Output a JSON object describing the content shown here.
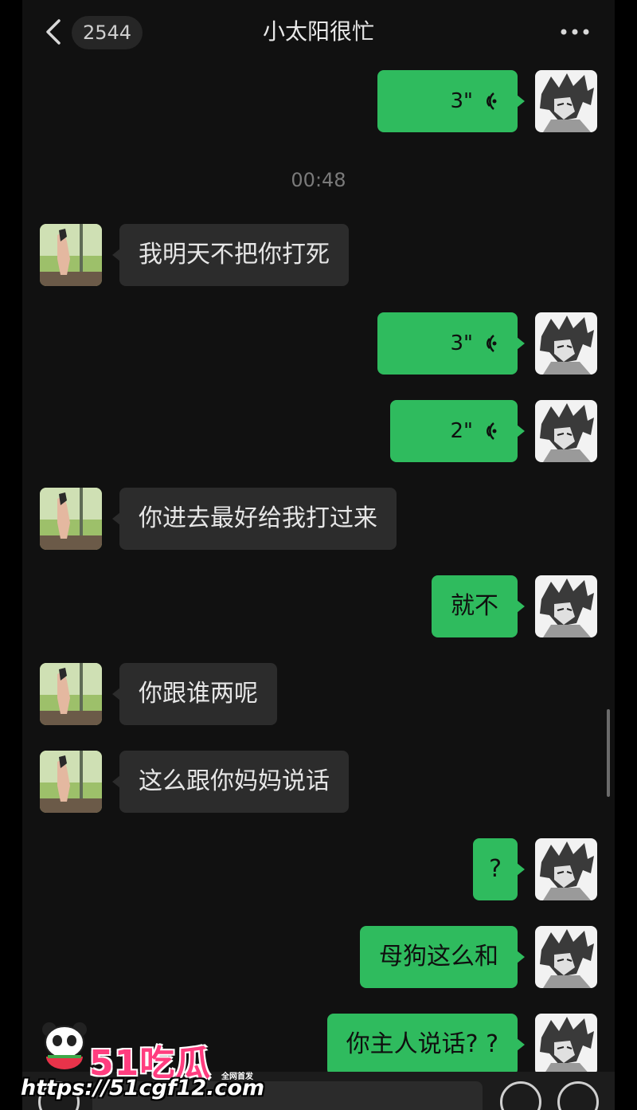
{
  "header": {
    "unread_count": "2544",
    "title": "小太阳很忙",
    "back_icon": "chevron-left-icon",
    "more_icon": "more-horizontal-icon"
  },
  "timestamp": "00:48",
  "messages": [
    {
      "side": "out",
      "type": "voice",
      "duration": "3\""
    },
    {
      "side": "in",
      "type": "text",
      "text": "我明天不把你打死"
    },
    {
      "side": "out",
      "type": "voice",
      "duration": "3\""
    },
    {
      "side": "out",
      "type": "voice",
      "duration": "2\""
    },
    {
      "side": "in",
      "type": "text",
      "text": "你进去最好给我打过来"
    },
    {
      "side": "out",
      "type": "text",
      "text": "就不"
    },
    {
      "side": "in",
      "type": "text",
      "text": "你跟谁两呢"
    },
    {
      "side": "in",
      "type": "text",
      "text": "这么跟你妈妈说话"
    },
    {
      "side": "out",
      "type": "text",
      "text": "?"
    },
    {
      "side": "out",
      "type": "text",
      "text": "母狗这么和"
    },
    {
      "side": "out",
      "type": "text",
      "text": "你主人说话? ?"
    }
  ],
  "colors": {
    "outgoing_bubble": "#2fbb5e",
    "incoming_bubble": "#2c2c2c",
    "background": "#111111"
  },
  "watermark": {
    "brand": "51吃瓜",
    "tag": "全网首发",
    "url": "https://51cgf12.com"
  }
}
